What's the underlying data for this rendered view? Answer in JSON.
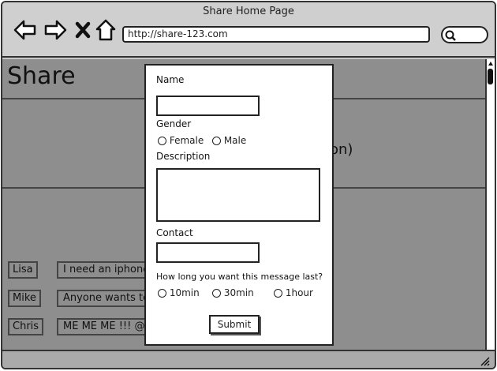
{
  "window": {
    "title": "Share Home Page",
    "url": "http://share-123.com"
  },
  "page": {
    "title": "Share",
    "partial_text": "on)"
  },
  "messages": [
    {
      "name": "Lisa",
      "text": "I need an iphone c"
    },
    {
      "name": "Mike",
      "text": "Anyone wants to p"
    },
    {
      "name": "Chris",
      "text": "ME ME ME !!! @Kc"
    }
  ],
  "modal": {
    "name_label": "Name",
    "gender_label": "Gender",
    "gender_options": [
      "Female",
      "Male"
    ],
    "description_label": "Description",
    "contact_label": "Contact",
    "duration_label": "How long you want this message last?",
    "duration_options": [
      "10min",
      "30min",
      "1hour"
    ],
    "submit_label": "Submit"
  },
  "icons": {
    "back": "arrow-left-icon",
    "forward": "arrow-right-icon",
    "stop": "close-icon",
    "home": "home-icon",
    "search": "search-icon"
  }
}
